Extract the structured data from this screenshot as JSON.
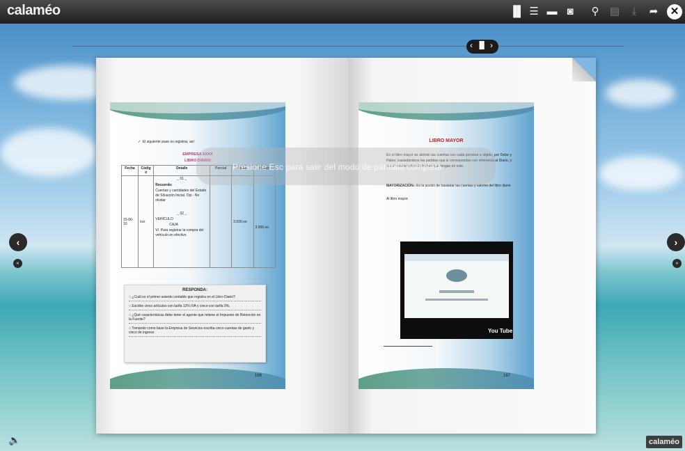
{
  "app": {
    "logo": "calaméo",
    "brand_badge": "calaméo"
  },
  "toolbar": {
    "icons": [
      "book-view-icon",
      "list-icon",
      "fullscreen-icon",
      "document-icon",
      "search-zoom-icon",
      "print-icon",
      "download-icon",
      "share-icon",
      "close-icon"
    ],
    "glyphs": {
      "book": "▐▌",
      "list": "☰",
      "fullscreen": "▬",
      "document": "◙",
      "zoom": "⚲",
      "print": "▤",
      "download": "⤓",
      "share": "➦",
      "close": "✕"
    }
  },
  "view_switch": {
    "prev": "‹",
    "book": "▐▌",
    "next": "›"
  },
  "overlay": {
    "text": "Presione Esc para salir del modo de pantalla completa"
  },
  "left_page": {
    "bullet": "El siguiente pase es registrar, así:",
    "company": "EMPRESA XXXX",
    "book_name": "LIBRO DIARIO",
    "table": {
      "headers": [
        "Fecha",
        "Códig o",
        "Detalle",
        "Parcial",
        "Debe",
        "Haber"
      ],
      "date": "15-06-10",
      "code": "xxx",
      "detail_lines": [
        "_ 01 _",
        "Recuerde:",
        "Cuentas y cantidades del Estado de Situación Inicial. Ojo - No olvidar",
        "_ 02 _",
        "VEHÍCULO",
        "CAJA",
        "V/. Para registrar la compra del vehículo en efectivo."
      ],
      "debe": "3.000,oo",
      "haber": "3.000,oo"
    },
    "quiz": {
      "heading": "RESPONDA:",
      "items": [
        "¿Cuál es el primer asiento contable que registra en el Libro Diario?",
        "Escribe cinco artículos con tarifa 12% IVA y cinco con tarifa 0%.",
        "¿Qué características debe tener el agente que retiene el Impuesto de Retención en la Fuente?",
        "Tomando como base la Empresa de Servicios escriba cinco cuentas de gasto y cinco de ingreso"
      ]
    },
    "page_number": "166"
  },
  "right_page": {
    "title": "LIBRO MAYOR",
    "intro": "En el libro mayor se abrirán las cuentas con cada persona u objeto, por Debe y Haber, trasladándose las partidas que le correspondan con referencia al Diario, y por el mismo orden de fechas que tengan en este.",
    "mayorizacion_label": "MAYORIZACIÓN.-",
    "mayorizacion_text": "Es la acción de trasladar las cuentas y valores del libro diario",
    "al_libro": "Al libro mayor.",
    "video_badge": "You Tube",
    "page_number": "167"
  },
  "nav": {
    "prev": "‹",
    "next": "›",
    "first": "«",
    "last": "»"
  },
  "sound": {
    "icon": "speaker-icon",
    "glyph": "🔈"
  }
}
